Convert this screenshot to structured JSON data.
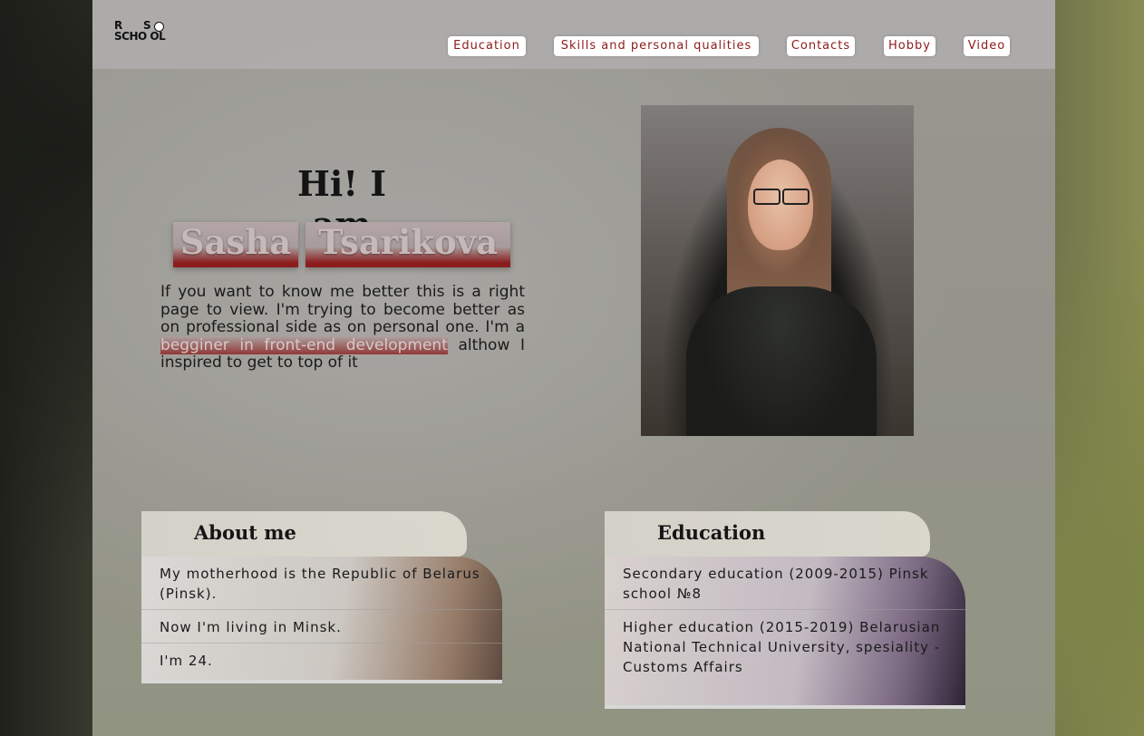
{
  "logo": {
    "line1a": "R",
    "line1b": "S",
    "line2": "SCHO OL"
  },
  "nav": [
    {
      "label": "Education"
    },
    {
      "label": "Skills and personal qualities"
    },
    {
      "label": "Contacts"
    },
    {
      "label": "Hobby"
    },
    {
      "label": "Video"
    }
  ],
  "hero": {
    "greeting": "Hi! I am",
    "first_name": "Sasha",
    "last_name": "Tsarikova",
    "intro_before": "If you want to know me better this is a right page to view. I'm trying to become better as on professional side as on personal one. I'm a ",
    "intro_highlight": "begginer in front-end development",
    "intro_after": " althow I inspired to get to top of it"
  },
  "about": {
    "title": "About me",
    "items": [
      "My motherhood is the Republic of Belarus (Pinsk).",
      "Now I'm living in Minsk.",
      "I'm 24."
    ]
  },
  "education": {
    "title": "Education",
    "items": [
      "Secondary education (2009-2015) Pinsk school №8",
      "Higher education (2015-2019) Belarusian National Technical University, spesiality - Customs Affairs"
    ]
  }
}
